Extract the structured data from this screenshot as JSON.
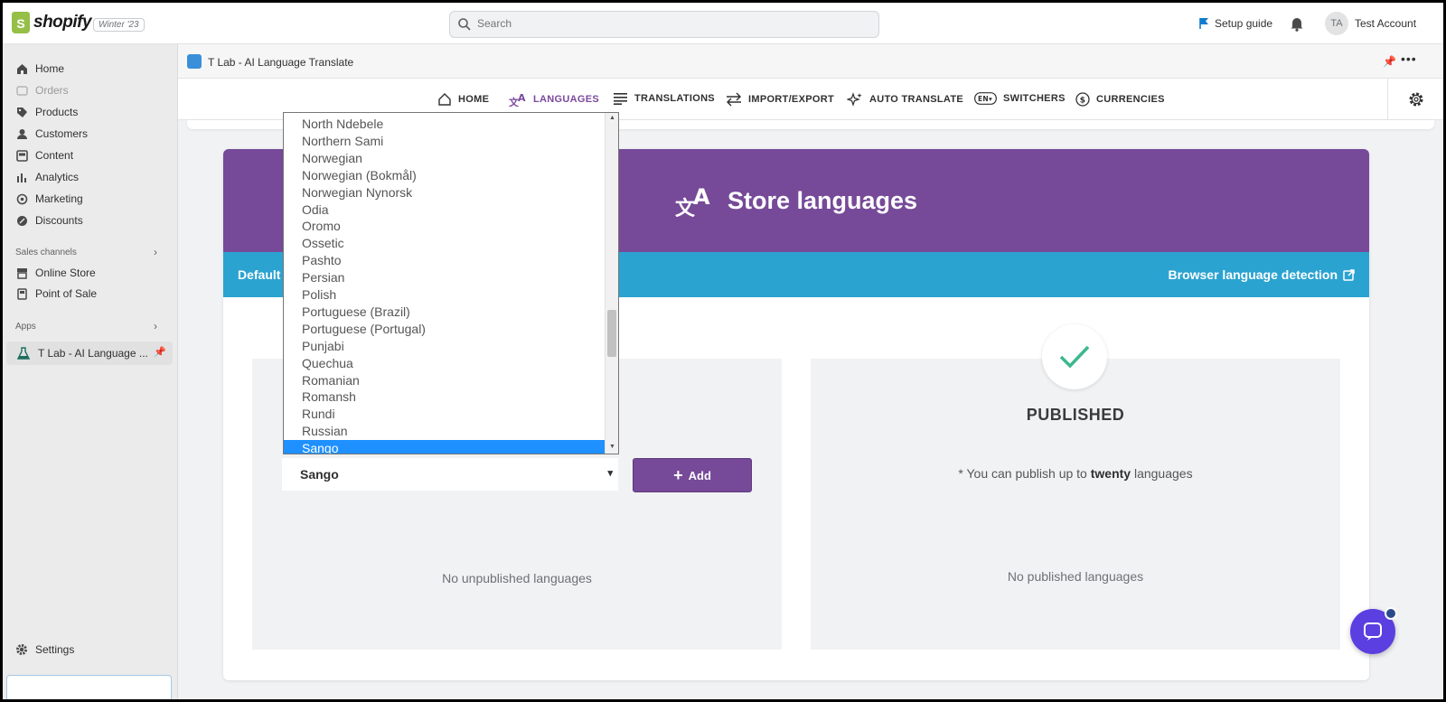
{
  "topbar": {
    "logo_text": "shopify",
    "version": "Winter '23",
    "search_placeholder": "Search",
    "setup_guide": "Setup guide",
    "avatar_initials": "TA",
    "account_name": "Test Account"
  },
  "sidebar": {
    "items": [
      {
        "label": "Home",
        "icon": "home-icon"
      },
      {
        "label": "Orders",
        "icon": "orders-icon",
        "disabled": true
      },
      {
        "label": "Products",
        "icon": "tag-icon"
      },
      {
        "label": "Customers",
        "icon": "person-icon"
      },
      {
        "label": "Content",
        "icon": "content-icon"
      },
      {
        "label": "Analytics",
        "icon": "analytics-icon"
      },
      {
        "label": "Marketing",
        "icon": "marketing-icon"
      },
      {
        "label": "Discounts",
        "icon": "discount-icon"
      }
    ],
    "sales_channels_label": "Sales channels",
    "sales_channels": [
      {
        "label": "Online Store",
        "icon": "store-icon"
      },
      {
        "label": "Point of Sale",
        "icon": "pos-icon"
      }
    ],
    "apps_label": "Apps",
    "app_item": "T Lab - AI Language ...",
    "settings": "Settings"
  },
  "app_header": {
    "title": "T Lab - AI Language Translate"
  },
  "app_nav": {
    "tabs": [
      {
        "label": "HOME",
        "icon": "home-outline-icon"
      },
      {
        "label": "LANGUAGES",
        "icon": "translate-icon",
        "active": true
      },
      {
        "label": "TRANSLATIONS",
        "icon": "lines-icon"
      },
      {
        "label": "IMPORT/EXPORT",
        "icon": "swap-icon"
      },
      {
        "label": "AUTO TRANSLATE",
        "icon": "sparkle-icon"
      },
      {
        "label": "SWITCHERS",
        "icon": "language-switch-icon"
      },
      {
        "label": "CURRENCIES",
        "icon": "currency-icon"
      }
    ]
  },
  "main": {
    "banner_title": "Store languages",
    "default_label": "Default",
    "browser_detection": "Browser language detection",
    "select_value": "Sango",
    "add_label": "Add",
    "unpublished_empty": "No unpublished languages",
    "published_title": "PUBLISHED",
    "publish_note_prefix": "* You can publish up to ",
    "publish_note_bold": "twenty",
    "publish_note_suffix": " languages",
    "published_empty": "No published languages"
  },
  "dropdown": {
    "options": [
      "North Ndebele",
      "Northern Sami",
      "Norwegian",
      "Norwegian (Bokmål)",
      "Norwegian Nynorsk",
      "Odia",
      "Oromo",
      "Ossetic",
      "Pashto",
      "Persian",
      "Polish",
      "Portuguese (Brazil)",
      "Portuguese (Portugal)",
      "Punjabi",
      "Quechua",
      "Romanian",
      "Romansh",
      "Rundi",
      "Russian",
      "Sango"
    ],
    "selected": "Sango"
  },
  "colors": {
    "purple": "#764a98",
    "blue": "#2ba3d1",
    "selected": "#1e90ff",
    "check": "#3cb88c"
  }
}
